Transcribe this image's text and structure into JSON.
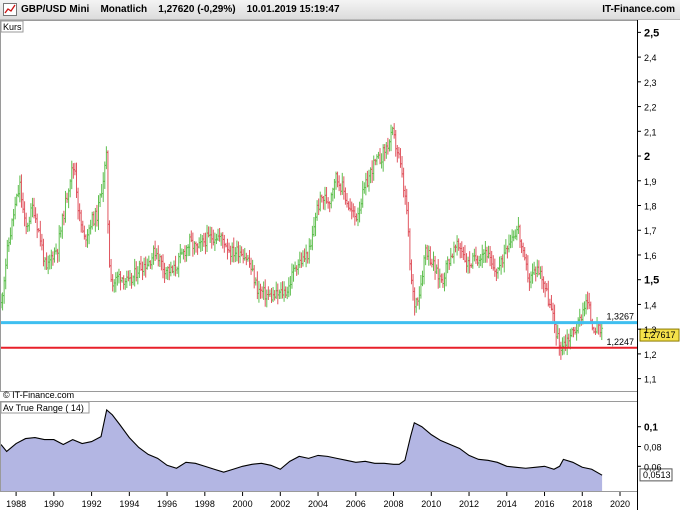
{
  "header": {
    "instrument": "GBP/USD Mini",
    "period": "Monatlich",
    "last": "1,27620 (-0,29%)",
    "datetime": "10.01.2019 15:19:47",
    "brand": "IT-Finance.com"
  },
  "price_panel": {
    "label": "Kurs",
    "watermark": "IT-Finance.com",
    "line_blue": {
      "value": 1.3267,
      "label": "1,3267",
      "color": "#3fbff0"
    },
    "line_red": {
      "value": 1.2247,
      "label": "1,2247",
      "color": "#e8202a"
    },
    "last_tag": "1,27617",
    "last_value": 1.27617
  },
  "atr_panel": {
    "label": "Av True Range ( 14)",
    "last_tag": "0,0513",
    "last_value": 0.0513
  },
  "colors": {
    "up": "#5fbf4f",
    "down": "#e0555f",
    "atr_fill": "#b3b6e3",
    "atr_line": "#000000"
  },
  "chart_data": [
    {
      "type": "ohlc",
      "title": "GBP/USD Mini Monatlich",
      "ylabel": "Kurs",
      "ylim": [
        1.05,
        2.55
      ],
      "yticks": [
        "2,5",
        "2,4",
        "2,3",
        "2,2",
        "2,1",
        "2",
        "1,9",
        "1,8",
        "1,7",
        "1,6",
        "1,5",
        "1,4",
        "1,3",
        "1,2",
        "1,1"
      ],
      "ytick_values": [
        2.5,
        2.4,
        2.3,
        2.2,
        2.1,
        2.0,
        1.9,
        1.8,
        1.7,
        1.6,
        1.5,
        1.4,
        1.3,
        1.2,
        1.1
      ],
      "xticks": [
        "1988",
        "1990",
        "1992",
        "1994",
        "1996",
        "1998",
        "2000",
        "2002",
        "2004",
        "2006",
        "2008",
        "2010",
        "2012",
        "2014",
        "2016",
        "2018",
        "2020"
      ],
      "x_range": [
        1987.2,
        2020.9
      ],
      "close_path": [
        [
          1987.2,
          1.4
        ],
        [
          1987.5,
          1.6
        ],
        [
          1987.9,
          1.78
        ],
        [
          1988.2,
          1.88
        ],
        [
          1988.5,
          1.7
        ],
        [
          1988.9,
          1.8
        ],
        [
          1989.3,
          1.66
        ],
        [
          1989.6,
          1.53
        ],
        [
          1989.9,
          1.6
        ],
        [
          1990.2,
          1.63
        ],
        [
          1990.6,
          1.8
        ],
        [
          1990.9,
          1.93
        ],
        [
          1991.1,
          1.96
        ],
        [
          1991.3,
          1.78
        ],
        [
          1991.6,
          1.66
        ],
        [
          1992.0,
          1.74
        ],
        [
          1992.3,
          1.76
        ],
        [
          1992.7,
          1.95
        ],
        [
          1992.8,
          2.0
        ],
        [
          1992.9,
          1.6
        ],
        [
          1993.1,
          1.48
        ],
        [
          1993.5,
          1.52
        ],
        [
          1994.0,
          1.48
        ],
        [
          1994.5,
          1.55
        ],
        [
          1995.0,
          1.57
        ],
        [
          1995.4,
          1.62
        ],
        [
          1995.8,
          1.55
        ],
        [
          1996.3,
          1.53
        ],
        [
          1996.8,
          1.6
        ],
        [
          1997.2,
          1.65
        ],
        [
          1997.6,
          1.62
        ],
        [
          1998.0,
          1.66
        ],
        [
          1998.6,
          1.68
        ],
        [
          1999.0,
          1.66
        ],
        [
          1999.4,
          1.61
        ],
        [
          1999.9,
          1.62
        ],
        [
          2000.3,
          1.58
        ],
        [
          2000.8,
          1.46
        ],
        [
          2001.2,
          1.44
        ],
        [
          2001.6,
          1.43
        ],
        [
          2001.9,
          1.44
        ],
        [
          2002.4,
          1.46
        ],
        [
          2002.8,
          1.56
        ],
        [
          2003.2,
          1.58
        ],
        [
          2003.6,
          1.62
        ],
        [
          2003.9,
          1.78
        ],
        [
          2004.2,
          1.83
        ],
        [
          2004.6,
          1.82
        ],
        [
          2004.9,
          1.92
        ],
        [
          2005.3,
          1.87
        ],
        [
          2005.7,
          1.78
        ],
        [
          2006.0,
          1.75
        ],
        [
          2006.4,
          1.85
        ],
        [
          2006.9,
          1.96
        ],
        [
          2007.3,
          1.99
        ],
        [
          2007.8,
          2.06
        ],
        [
          2007.95,
          2.09
        ],
        [
          2008.3,
          1.99
        ],
        [
          2008.7,
          1.78
        ],
        [
          2008.9,
          1.52
        ],
        [
          2009.1,
          1.4
        ],
        [
          2009.4,
          1.46
        ],
        [
          2009.7,
          1.63
        ],
        [
          2009.9,
          1.6
        ],
        [
          2010.3,
          1.52
        ],
        [
          2010.6,
          1.5
        ],
        [
          2010.9,
          1.58
        ],
        [
          2011.3,
          1.63
        ],
        [
          2011.6,
          1.63
        ],
        [
          2011.9,
          1.56
        ],
        [
          2012.3,
          1.58
        ],
        [
          2012.7,
          1.61
        ],
        [
          2012.9,
          1.62
        ],
        [
          2013.3,
          1.53
        ],
        [
          2013.7,
          1.56
        ],
        [
          2013.95,
          1.64
        ],
        [
          2014.3,
          1.68
        ],
        [
          2014.6,
          1.71
        ],
        [
          2014.9,
          1.58
        ],
        [
          2015.2,
          1.5
        ],
        [
          2015.6,
          1.55
        ],
        [
          2015.9,
          1.51
        ],
        [
          2016.2,
          1.42
        ],
        [
          2016.5,
          1.33
        ],
        [
          2016.8,
          1.23
        ],
        [
          2017.0,
          1.24
        ],
        [
          2017.4,
          1.28
        ],
        [
          2017.8,
          1.32
        ],
        [
          2018.1,
          1.4
        ],
        [
          2018.3,
          1.41
        ],
        [
          2018.5,
          1.32
        ],
        [
          2018.8,
          1.3
        ],
        [
          2019.05,
          1.28
        ]
      ],
      "annotations": [
        "1,3267",
        "1,2247",
        "1,27617"
      ]
    },
    {
      "type": "area",
      "title": "Av True Range ( 14)",
      "ylim": [
        0.035,
        0.125
      ],
      "yticks": [
        "0,1",
        "0,08",
        "0,06"
      ],
      "ytick_values": [
        0.1,
        0.08,
        0.06
      ],
      "x_range": [
        1987.2,
        2020.9
      ],
      "x": [
        1987.2,
        1987.5,
        1988.0,
        1988.5,
        1989.0,
        1989.5,
        1990.0,
        1990.5,
        1991.0,
        1991.5,
        1992.0,
        1992.5,
        1992.8,
        1993.1,
        1993.5,
        1994.0,
        1994.5,
        1995.0,
        1995.5,
        1996.0,
        1996.5,
        1997.0,
        1997.5,
        1998.0,
        1998.5,
        1999.0,
        1999.5,
        2000.0,
        2000.5,
        2001.0,
        2001.5,
        2002.0,
        2002.5,
        2003.0,
        2003.5,
        2004.0,
        2004.5,
        2005.0,
        2005.5,
        2006.0,
        2006.5,
        2007.0,
        2007.5,
        2008.0,
        2008.3,
        2008.6,
        2008.9,
        2009.1,
        2009.5,
        2010.0,
        2010.5,
        2011.0,
        2011.5,
        2012.0,
        2012.5,
        2013.0,
        2013.5,
        2014.0,
        2014.5,
        2015.0,
        2015.5,
        2016.0,
        2016.5,
        2016.8,
        2017.0,
        2017.5,
        2018.0,
        2018.5,
        2019.05
      ],
      "values": [
        0.082,
        0.075,
        0.083,
        0.088,
        0.089,
        0.087,
        0.087,
        0.082,
        0.087,
        0.083,
        0.085,
        0.09,
        0.117,
        0.112,
        0.102,
        0.089,
        0.079,
        0.072,
        0.068,
        0.061,
        0.058,
        0.064,
        0.063,
        0.06,
        0.057,
        0.054,
        0.057,
        0.06,
        0.062,
        0.063,
        0.061,
        0.057,
        0.065,
        0.07,
        0.068,
        0.071,
        0.07,
        0.068,
        0.066,
        0.064,
        0.065,
        0.063,
        0.063,
        0.062,
        0.062,
        0.066,
        0.09,
        0.104,
        0.1,
        0.092,
        0.086,
        0.082,
        0.078,
        0.071,
        0.067,
        0.066,
        0.064,
        0.06,
        0.059,
        0.058,
        0.059,
        0.06,
        0.057,
        0.06,
        0.067,
        0.064,
        0.059,
        0.057,
        0.051
      ]
    }
  ]
}
